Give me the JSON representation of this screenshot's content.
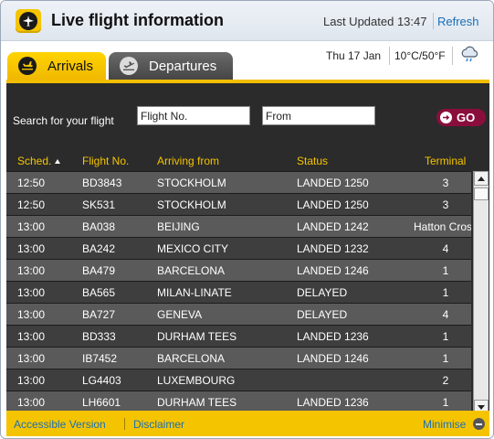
{
  "header": {
    "title": "Live flight information",
    "last_updated": "Last Updated 13:47",
    "refresh_label": "Refresh"
  },
  "info": {
    "date": "Thu 17 Jan",
    "temperature": "10°C/50°F",
    "weather_icon": "cloud-rain-icon"
  },
  "tabs": [
    {
      "label": "Arrivals",
      "icon": "arrival-plane-icon",
      "active": true
    },
    {
      "label": "Departures",
      "icon": "departure-plane-icon",
      "active": false
    }
  ],
  "search": {
    "label": "Search for your flight",
    "flight_value": "Flight No.",
    "from_value": "From",
    "go_label": "GO"
  },
  "table": {
    "columns": [
      "Sched.",
      "Flight No.",
      "Arriving from",
      "Status",
      "Terminal"
    ],
    "rows": [
      [
        "12:50",
        "BD3843",
        "STOCKHOLM",
        "LANDED 1250",
        "3"
      ],
      [
        "12:50",
        "SK531",
        "STOCKHOLM",
        "LANDED 1250",
        "3"
      ],
      [
        "13:00",
        "BA038",
        "BEIJING",
        "LANDED 1242",
        "Hatton Cross"
      ],
      [
        "13:00",
        "BA242",
        "MEXICO CITY",
        "LANDED 1232",
        "4"
      ],
      [
        "13:00",
        "BA479",
        "BARCELONA",
        "LANDED 1246",
        "1"
      ],
      [
        "13:00",
        "BA565",
        "MILAN-LINATE",
        "DELAYED",
        "1"
      ],
      [
        "13:00",
        "BA727",
        "GENEVA",
        "DELAYED",
        "4"
      ],
      [
        "13:00",
        "BD333",
        "DURHAM TEES",
        "LANDED 1236",
        "1"
      ],
      [
        "13:00",
        "IB7452",
        "BARCELONA",
        "LANDED 1246",
        "1"
      ],
      [
        "13:00",
        "LG4403",
        "LUXEMBOURG",
        "",
        "2"
      ],
      [
        "13:00",
        "LH6601",
        "DURHAM TEES",
        "LANDED 1236",
        "1"
      ]
    ]
  },
  "footer": {
    "accessible_label": "Accessible Version",
    "disclaimer_label": "Disclaimer",
    "minimise_label": "Minimise"
  },
  "colors": {
    "accent_yellow": "#f5c400",
    "panel_dark": "#2b2b2b",
    "link_blue": "#1a6fb5",
    "go_button": "#8a0e3b"
  }
}
